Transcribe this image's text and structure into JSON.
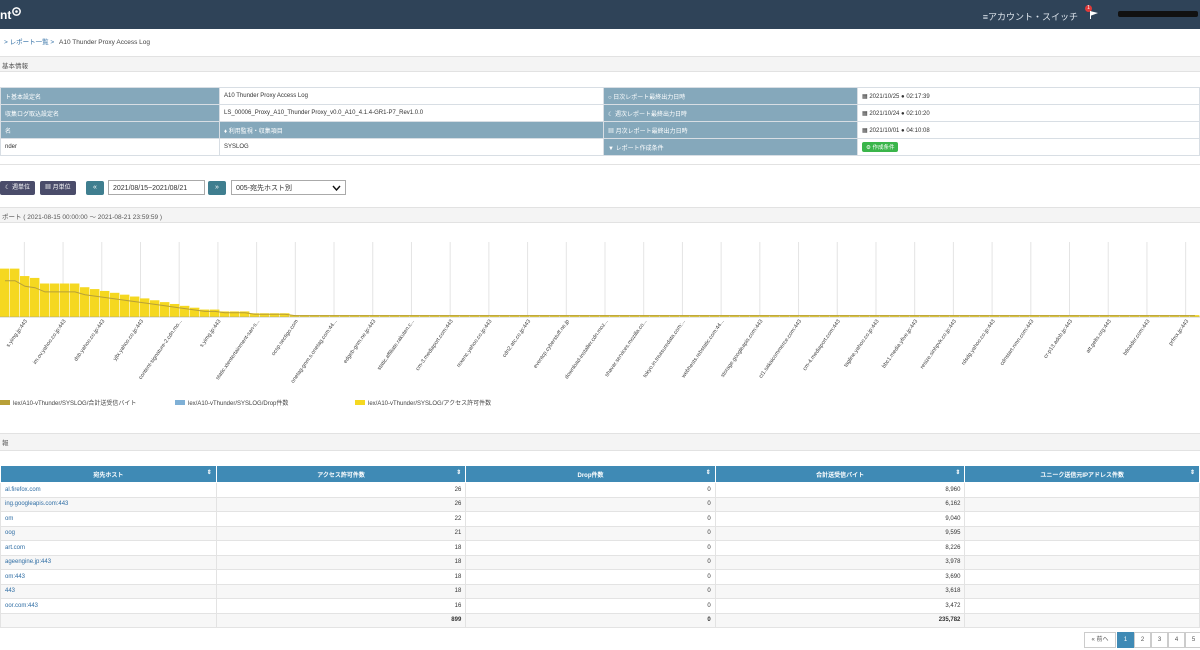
{
  "header": {
    "brand": "nt",
    "account_switch": "≡アカウント・スイッチ",
    "notif_count": "1"
  },
  "breadcrumb": [
    "> レポート一覧 >",
    "A10 Thunder Proxy Access Log"
  ],
  "sections": {
    "basic": "基本情報",
    "chart_header": "ポート ( 2021-08-15 00:00:00 ～ 2021-08-21 23:59:59 )",
    "detail": "報"
  },
  "info": {
    "rows": [
      {
        "l1": "ト基本設定名",
        "v1": "A10 Thunder Proxy Access Log",
        "l2": "日次レポート最終出力日時",
        "v2": "2021/10/25 ● 02:17:39"
      },
      {
        "l1": "収集ログ取込設定名",
        "v1": "LS_00006_Proxy_A10_Thunder Proxy_v0.0_A10_4.1.4-GR1-P7_Rev1.0.0",
        "l2": "週次レポート最終出力日時",
        "v2": "2021/10/24 ● 02:10:20"
      },
      {
        "l1": "名",
        "v1": "♦ 利用監視・収集項目",
        "l2": "月次レポート最終出力日時",
        "v2": "2021/10/01 ● 04:10:08"
      },
      {
        "l1": "nder",
        "v1": "SYSLOG",
        "l2": "レポート作成条件",
        "v2": "作成条件"
      }
    ]
  },
  "controls": {
    "week_btn": "週単位",
    "month_btn": "月単位",
    "prev": "«",
    "next": "»",
    "date_range": "2021/08/15~2021/08/21",
    "report_select": "005-宛先ホスト別"
  },
  "chart_data": {
    "type": "bar",
    "categories": [
      "s.yimg.jp:443",
      "im.ov.yahoo.co.jp:443",
      "dsb.yahoo.co.jp:443",
      "yjtx.yahoo.co.jp:443",
      "content-signature-2.cdn.mo...",
      "s.yimg.jp:443",
      "static.xtentertainment-san-s...",
      "ocsp.sectigo.com",
      "onetag-gnm.s.onetag.com:44...",
      "edgeb-gnm.ne.jp:443",
      "static.affiliate.rakuten.c...",
      "cm-3.mediaport.com:443",
      "rexenc.yahoo.co.jp:443",
      "cdn2.atc.co.jp:443",
      "eventcp.cyberstuff.ne.jp",
      "download-installer.cdn.moz...",
      "shavar.services.mozilla.co...",
      "tokyo.in.treasuredata.com:...",
      "webhests.rebstatic.com:44...",
      "storage.googleapis.com:443",
      "ct1.sakaicommerce.com:443",
      "cm-4.mediaport.com:443",
      "tagline.yahoo.co.jp:443",
      "bbc1.media.yfive.jp:443",
      "resize.sinhpvk.co.jp:443",
      "rdsdg.yahoo.co.jp:443",
      "cdnstart.nmn.com:443",
      "cr-p13.adob.jp:443",
      "att.gelts.org:443",
      "btloader.com:443",
      "prfmx.jp:443"
    ],
    "series": [
      {
        "name": "lex/A10-vThunder/SYSLOG/アクセス許可件数",
        "values": [
          26,
          26,
          22,
          21,
          18,
          18,
          18,
          18,
          16,
          15,
          14,
          13,
          12,
          11,
          10,
          9,
          8,
          7,
          6,
          5,
          4,
          4,
          3,
          3,
          3,
          2,
          2,
          2,
          2,
          1,
          1,
          1,
          1,
          1,
          1,
          1,
          1,
          1,
          1,
          1,
          1,
          1,
          1,
          1,
          1,
          1,
          1,
          1,
          1,
          1,
          1,
          1,
          1,
          1,
          1,
          1,
          1,
          1,
          1,
          1,
          1,
          1,
          1,
          1,
          1,
          1,
          1,
          1,
          1,
          1,
          1,
          1,
          1,
          1,
          1,
          1,
          1,
          1,
          1,
          1,
          1,
          1,
          1,
          1,
          1,
          1,
          1,
          1,
          1,
          1,
          1,
          1,
          1,
          1,
          1,
          1,
          1,
          1,
          1,
          1,
          1,
          1,
          1,
          1,
          1,
          1,
          1,
          1,
          1,
          1,
          1,
          1,
          1,
          1,
          1,
          1,
          1,
          1,
          1,
          1
        ]
      },
      {
        "name": "lex/A10-vThunder/SYSLOG/Drop件数",
        "values": []
      },
      {
        "name": "lex/A10-vThunder/SYSLOG/合計送受信バイト",
        "values": []
      }
    ],
    "grid": true
  },
  "legend": [
    {
      "label": "lex/A10-vThunder/SYSLOG/合計送受信バイト",
      "color": "#b8a038"
    },
    {
      "label": "lex/A10-vThunder/SYSLOG/Drop件数",
      "color": "#7fb0d6"
    },
    {
      "label": "lex/A10-vThunder/SYSLOG/アクセス許可件数",
      "color": "#f5d820"
    }
  ],
  "table": {
    "headers": [
      "宛先ホスト",
      "アクセス許可件数",
      "Drop件数",
      "合計送受信バイト",
      "ユニーク送信元IPアドレス件数"
    ],
    "rows": [
      [
        "al.firefox.com",
        "26",
        "0",
        "8,960"
      ],
      [
        "ing.googleapis.com:443",
        "26",
        "0",
        "6,162"
      ],
      [
        "om",
        "22",
        "0",
        "9,040"
      ],
      [
        "oog",
        "21",
        "0",
        "9,595"
      ],
      [
        "art.com",
        "18",
        "0",
        "8,226"
      ],
      [
        "ageengine.jp:443",
        "18",
        "0",
        "3,978"
      ],
      [
        "om:443",
        "18",
        "0",
        "3,690"
      ],
      [
        "443",
        "18",
        "0",
        "3,618"
      ],
      [
        "oor.com:443",
        "16",
        "0",
        "3,472"
      ]
    ],
    "totals": [
      "",
      "899",
      "0",
      "235,782"
    ]
  },
  "pager": {
    "prev": "« 前へ",
    "pages": [
      "1",
      "2",
      "3",
      "4",
      "5"
    ]
  }
}
